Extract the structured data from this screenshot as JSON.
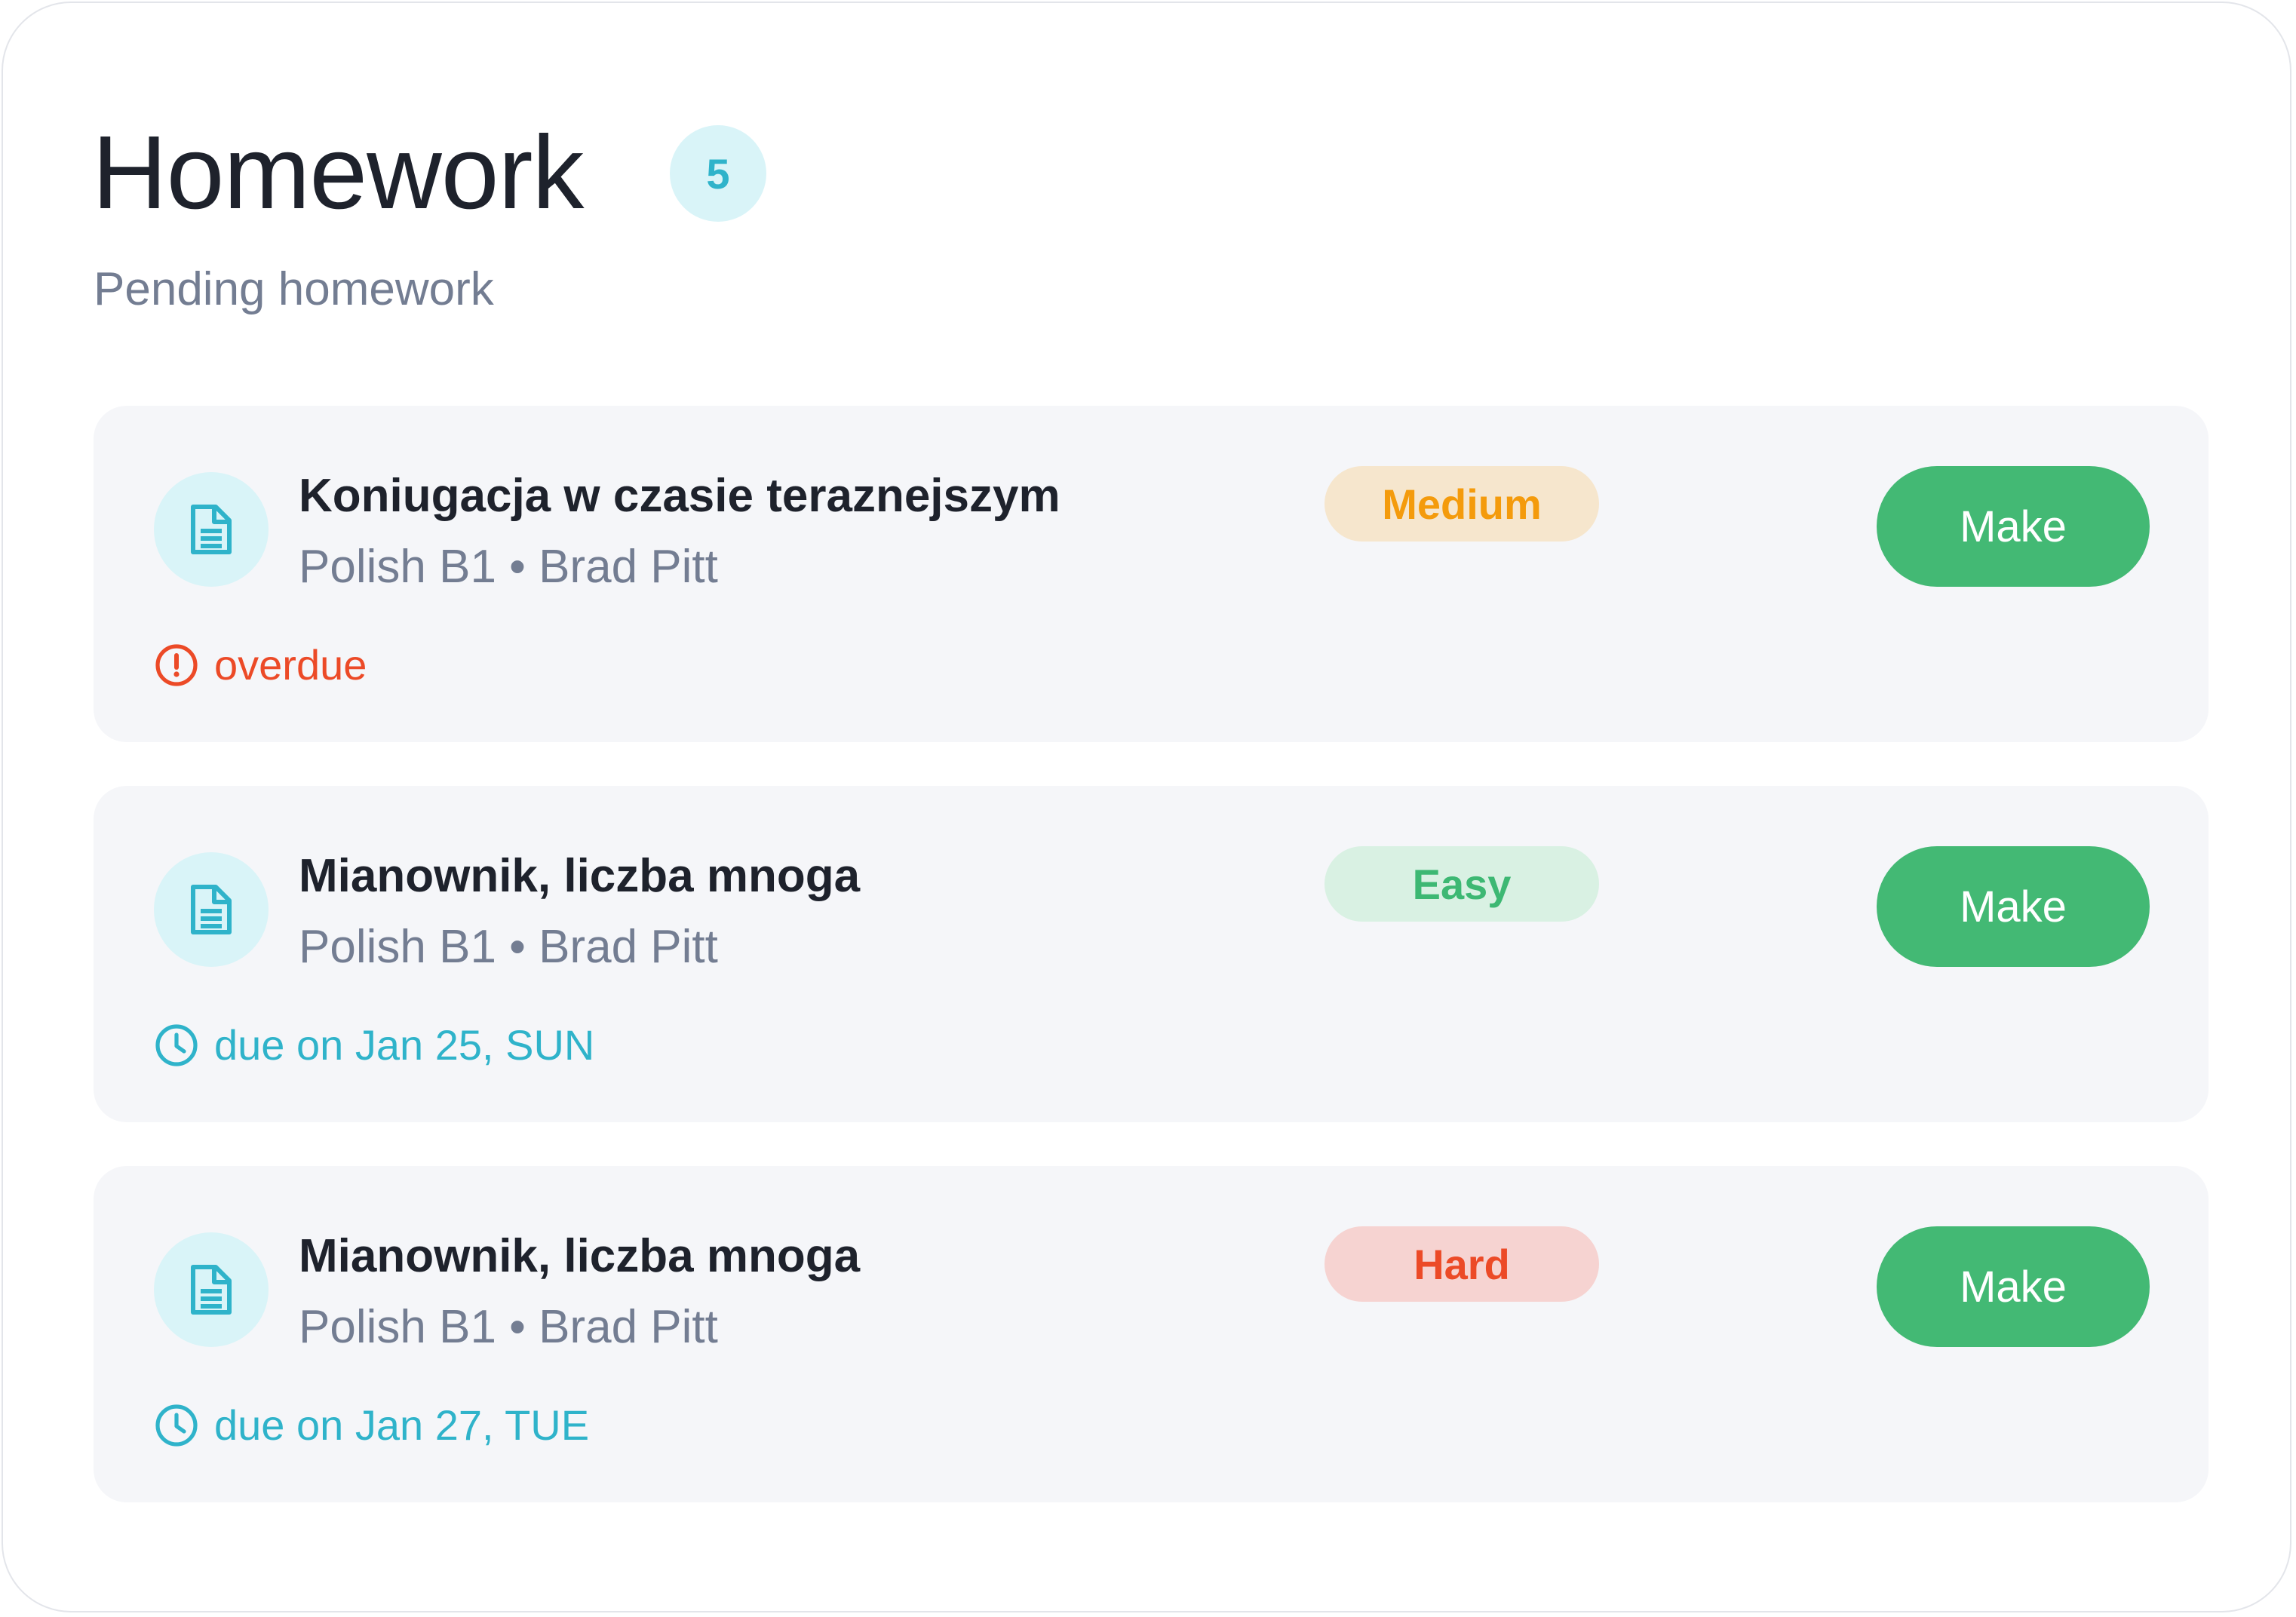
{
  "header": {
    "title": "Homework",
    "count": "5",
    "subtitle": "Pending homework"
  },
  "items": [
    {
      "title": "Koniugacja w czasie teraznejszym",
      "meta": "Polish B1 • Brad Pitt",
      "status_type": "overdue",
      "status_icon": "alert-circle-icon",
      "status_text": "overdue",
      "difficulty": "Medium",
      "action_label": "Make"
    },
    {
      "title": "Mianownik, liczba mnoga",
      "meta": "Polish B1 • Brad Pitt",
      "status_type": "due",
      "status_icon": "clock-icon",
      "status_text": "due on Jan 25, SUN",
      "difficulty": "Easy",
      "action_label": "Make"
    },
    {
      "title": "Mianownik, liczba mnoga",
      "meta": "Polish B1 • Brad Pitt",
      "status_type": "due",
      "status_icon": "clock-icon",
      "status_text": "due on Jan 27, TUE",
      "difficulty": "Hard",
      "action_label": "Make"
    }
  ],
  "colors": {
    "accent_teal": "#2fb3ca",
    "button_green": "#43b974",
    "overdue_red": "#ec4a27",
    "medium_orange": "#f49b0c",
    "easy_green": "#3db873",
    "hard_red": "#ec4a27"
  }
}
